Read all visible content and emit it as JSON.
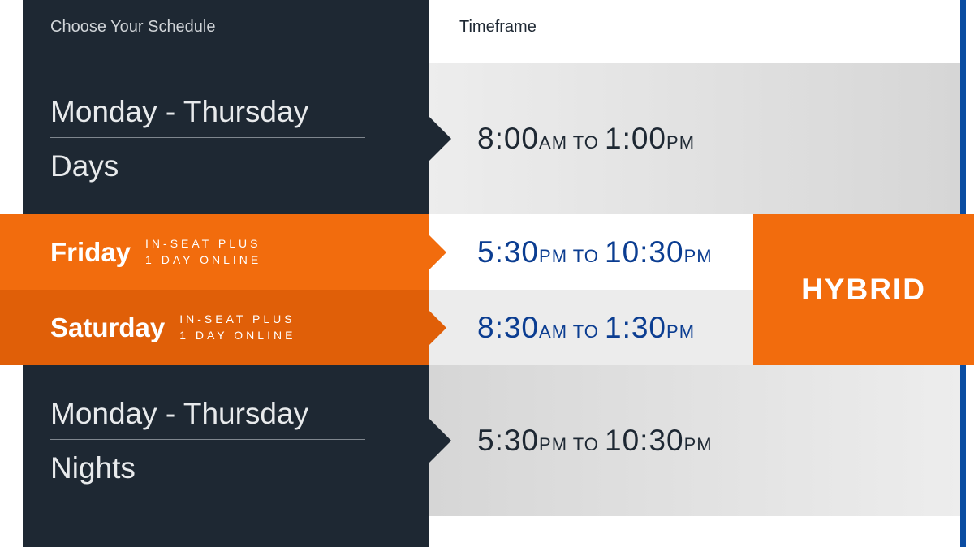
{
  "headers": {
    "left": "Choose Your Schedule",
    "right": "Timeframe"
  },
  "rows": [
    {
      "range": "Monday - Thursday",
      "period": "Days",
      "time_start": "8:00",
      "time_start_ampm": "AM",
      "time_join": " TO ",
      "time_end": "1:00",
      "time_end_ampm": "PM"
    },
    {
      "range": "Monday - Thursday",
      "period": "Nights",
      "time_start": "5:30",
      "time_start_ampm": "PM",
      "time_join": " TO ",
      "time_end": "10:30",
      "time_end_ampm": "PM"
    }
  ],
  "hybrid": {
    "badge": "HYBRID",
    "rows": [
      {
        "day": "Friday",
        "note_line1": "IN-SEAT PLUS",
        "note_line2": "1 DAY ONLINE",
        "time_start": "5:30",
        "time_start_ampm": "PM",
        "time_join": " TO ",
        "time_end": "10:30",
        "time_end_ampm": "PM"
      },
      {
        "day": "Saturday",
        "note_line1": "IN-SEAT PLUS",
        "note_line2": "1 DAY ONLINE",
        "time_start": "8:30",
        "time_start_ampm": "AM",
        "time_join": " TO ",
        "time_end": "1:30",
        "time_end_ampm": "PM"
      }
    ]
  }
}
